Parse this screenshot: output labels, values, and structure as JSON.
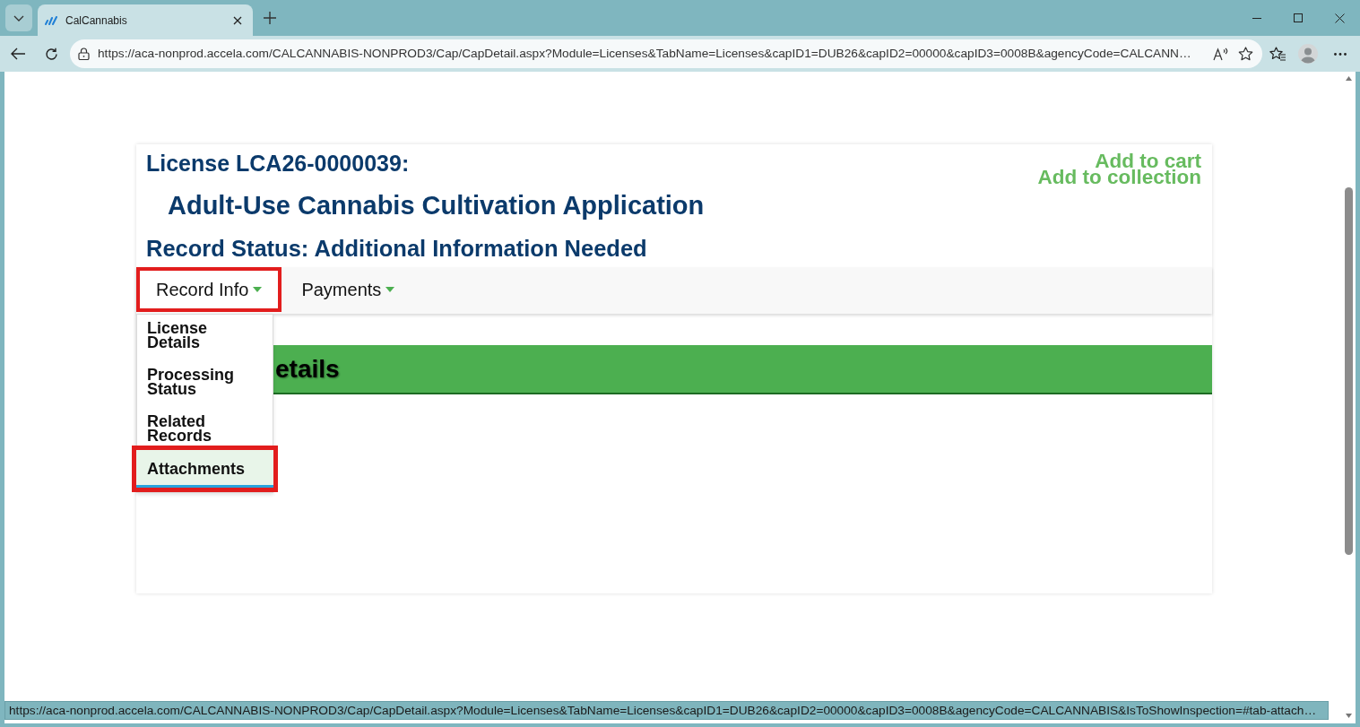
{
  "browser": {
    "tab": {
      "title": "CalCannabis"
    },
    "address_bar": {
      "url": "https://aca-nonprod.accela.com/CALCANNABIS-NONPROD3/Cap/CapDetail.aspx?Module=Licenses&TabName=Licenses&capID1=DUB26&capID2=00000&capID3=0008B&agencyCode=CALCANN…"
    }
  },
  "record": {
    "license_title": "License LCA26-0000039:",
    "application_title": "Adult-Use Cannabis Cultivation Application",
    "status": "Record Status: Additional Information Needed",
    "links": [
      "Add to cart",
      "Add to collection"
    ]
  },
  "nav": [
    {
      "label": "Record Info",
      "highlighted": true,
      "menu": [
        {
          "label": "License Details",
          "selected": false,
          "highlighted": false
        },
        {
          "label": "Processing Status",
          "selected": false,
          "highlighted": false
        },
        {
          "label": "Related Records",
          "selected": false,
          "highlighted": false
        },
        {
          "label": "Attachments",
          "selected": true,
          "highlighted": true
        }
      ]
    },
    {
      "label": "Payments",
      "highlighted": false
    }
  ],
  "section_heading": "etails",
  "status_bar": {
    "url": "https://aca-nonprod.accela.com/CALCANNABIS-NONPROD3/Cap/CapDetail.aspx?Module=Licenses&TabName=Licenses&capID1=DUB26&capID2=00000&capID3=0008B&agencyCode=CALCANNABIS&IsToShowInspection=#tab-attach…"
  }
}
